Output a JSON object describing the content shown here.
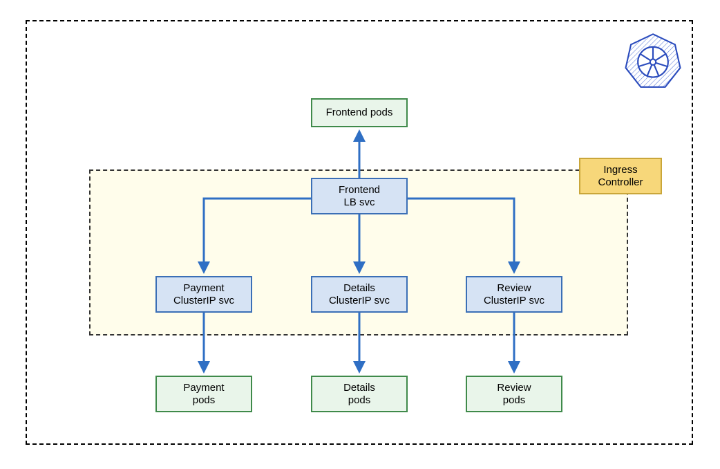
{
  "nodes": {
    "frontend_pods": {
      "label1": "Frontend pods"
    },
    "frontend_lb": {
      "label1": "Frontend",
      "label2": "LB svc"
    },
    "payment_svc": {
      "label1": "Payment",
      "label2": "ClusterIP svc"
    },
    "details_svc": {
      "label1": "Details",
      "label2": "ClusterIP svc"
    },
    "review_svc": {
      "label1": "Review",
      "label2": "ClusterIP svc"
    },
    "payment_pods": {
      "label1": "Payment",
      "label2": "pods"
    },
    "details_pods": {
      "label1": "Details",
      "label2": "pods"
    },
    "review_pods": {
      "label1": "Review",
      "label2": "pods"
    },
    "ingress": {
      "label1": "Ingress",
      "label2": "Controller"
    }
  },
  "colors": {
    "arrow": "#2f6fc4",
    "svc_fill": "#d6e3f4",
    "svc_border": "#3b6fb6",
    "pods_fill": "#e9f5ea",
    "pods_border": "#3f8a4a",
    "ingress_fill": "#f7d77a",
    "ingress_border": "#c9a63a",
    "panel_fill": "#fffdeb"
  }
}
